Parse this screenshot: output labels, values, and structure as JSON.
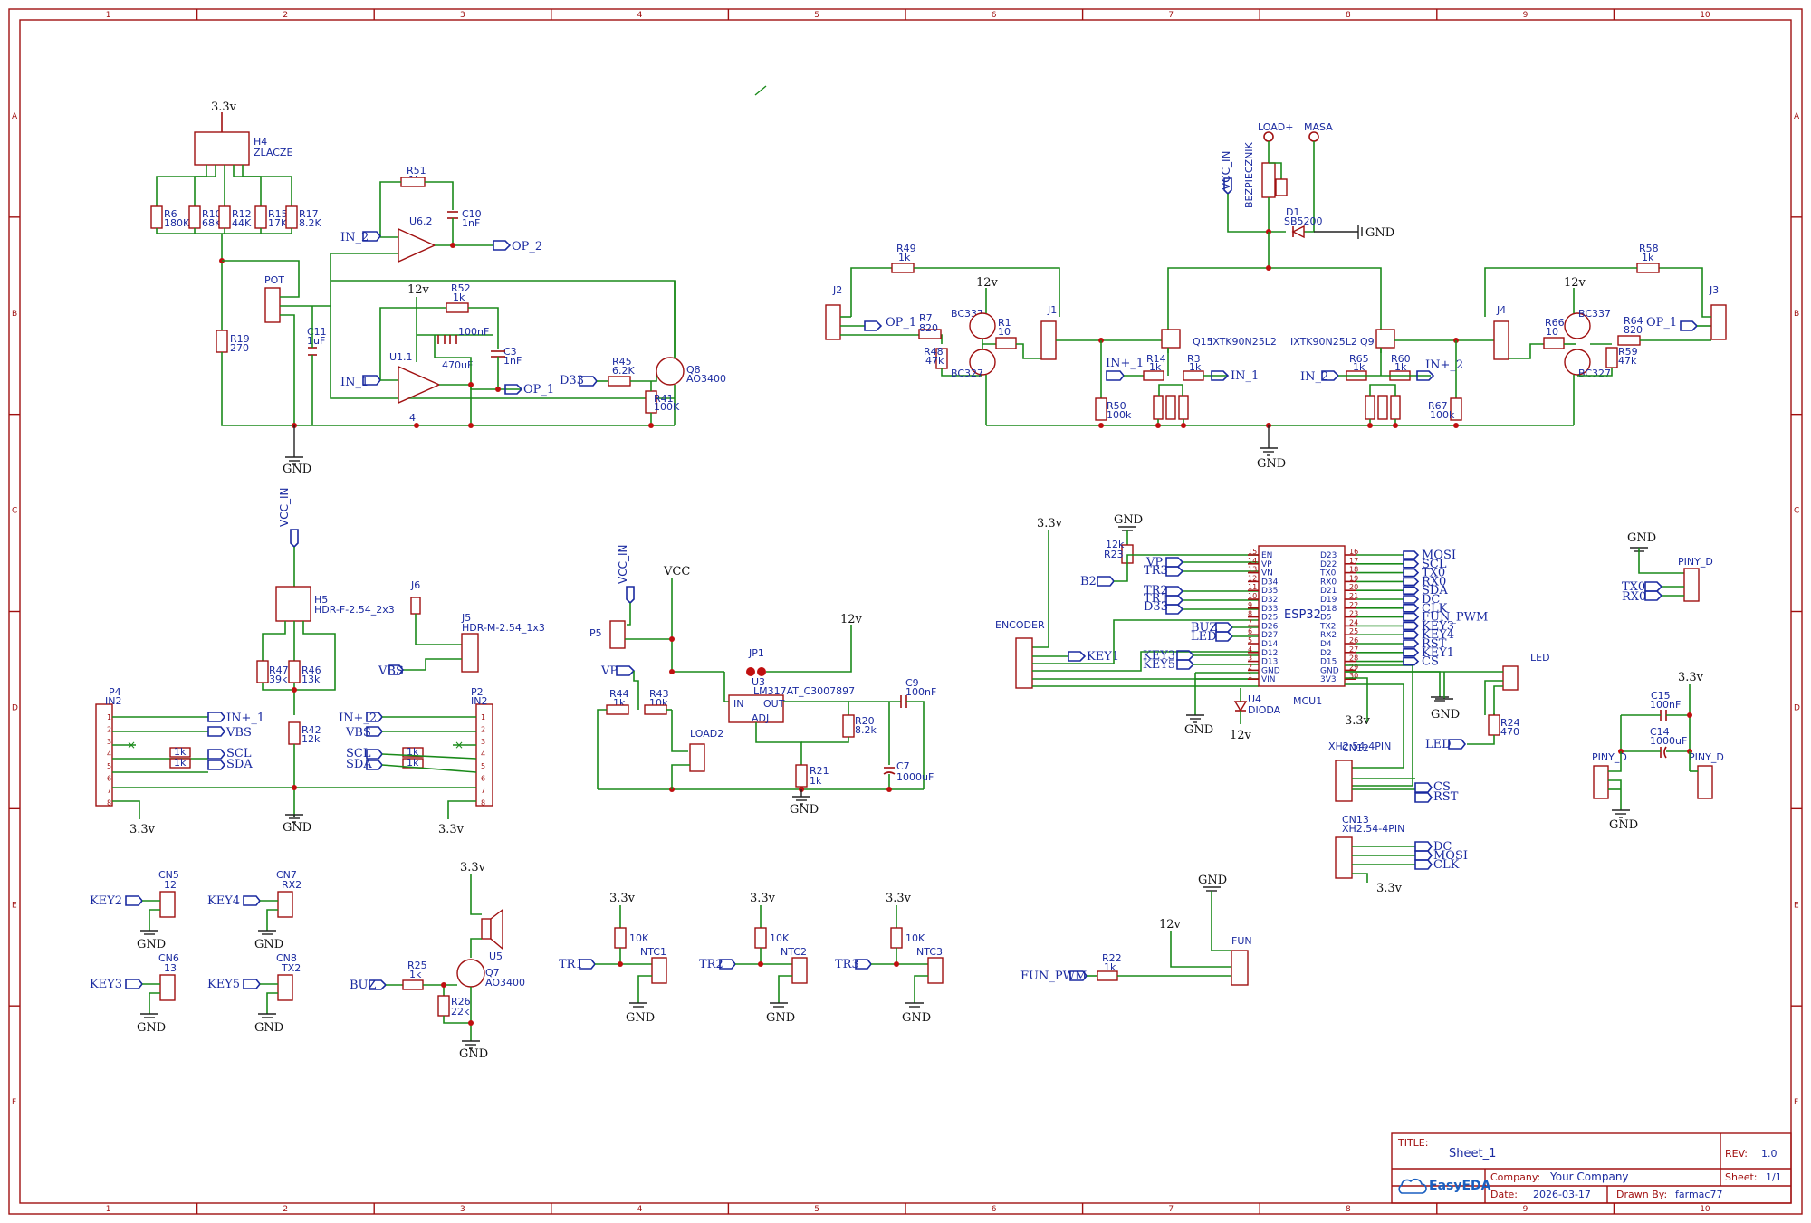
{
  "frame": {
    "cols": [
      "1",
      "2",
      "3",
      "4",
      "5",
      "6",
      "7",
      "8",
      "9",
      "10"
    ],
    "rows": [
      "A",
      "B",
      "C",
      "D",
      "E",
      "F"
    ]
  },
  "title_block": {
    "title_label": "TITLE:",
    "title": "Sheet_1",
    "rev_label": "REV:",
    "rev": "1.0",
    "company_label": "Company:",
    "company": "Your Company",
    "sheet_label": "Sheet:",
    "sheet": "1/1",
    "date_label": "Date:",
    "date": "2026-03-17",
    "drawn_label": "Drawn By:",
    "drawn": "farmac77",
    "logo": "EasyEDA"
  },
  "powers": {
    "v33": "3.3v",
    "v12": "12v",
    "gnd": "GND",
    "vcc": "VCC",
    "vcc_in": "VCC_IN"
  },
  "nets": {
    "in2": "IN_2",
    "in1": "IN_1",
    "op2": "OP_2",
    "op1": "OP_1",
    "d33": "D33",
    "in1p": "IN+_1",
    "in2p": "IN+_2",
    "vbs": "VBS",
    "scl": "SCL",
    "sda": "SDA",
    "vp": "VP",
    "tr3": "TR3",
    "b2": "B2",
    "tr2": "TR2",
    "tr1": "TR1",
    "d33b": "D33",
    "buz": "BUZ",
    "led": "LED",
    "key3": "KEY3",
    "key5": "KEY5",
    "key1": "KEY1",
    "key2": "KEY2",
    "key4": "KEY4",
    "tx0": "TX0",
    "rx0": "RX0",
    "fun_pwm": "FUN_PWM",
    "load_plus": "LOAD+",
    "masa": "MASA",
    "cs": "CS",
    "rst": "RST",
    "dc": "DC",
    "mosi": "MOSI",
    "clk": "CLK",
    "mcu_right": [
      "MOSI",
      "SCL",
      "TX0",
      "RX0",
      "SDA",
      "DC",
      "CLK",
      "FUN_PWM",
      "KEY3",
      "KEY4",
      "RST",
      "KEY1",
      "CS"
    ]
  },
  "parts": {
    "h4": "H4",
    "zlacze": "ZLACZE",
    "r6": "R6",
    "r6v": "180K",
    "r10": "R10",
    "r10v": "68K",
    "r12": "R12",
    "r12v": "44K",
    "r15": "R15",
    "r15v": "17K",
    "r17": "R17",
    "r17v": "8.2K",
    "r19": "R19",
    "r19v": "270",
    "pot": "POT",
    "c11": "C11",
    "c11v": "1uF",
    "r51": "R51",
    "r51v": "1k",
    "c10": "C10",
    "c10v": "1nF",
    "u62": "U6.2",
    "r52": "R52",
    "r52v": "1k",
    "u11": "U1.1",
    "c_470": "470uF",
    "c_100n": "100nF",
    "c3": "C3",
    "c3v": "1nF",
    "r45": "R45",
    "r45v": "6.2K",
    "q8": "Q8",
    "q8v": "AO3400",
    "r41": "R41",
    "r41v": "100K",
    "r49": "R49",
    "r49v": "1k",
    "j2": "J2",
    "r7": "R7",
    "r7v": "820",
    "r48": "R48",
    "r48v": "47k",
    "bc337": "BC337",
    "bc327": "BC327",
    "r1": "R1",
    "r1v": "10",
    "j1": "J1",
    "q15": "Q15",
    "ixtk": "IXTK90N25L2",
    "r14": "R14",
    "r14v": "1k",
    "r3": "R3",
    "r3v": "1k",
    "r50": "R50",
    "r50v": "100k",
    "bez": "BEZPIECZNIK",
    "d1": "D1",
    "d1v": "SB5200",
    "q9": "Q9",
    "r65": "R65",
    "r65v": "1k",
    "r60": "R60",
    "r60v": "1k",
    "r67": "R67",
    "r67v": "100k",
    "r58": "R58",
    "r58v": "1k",
    "j4": "J4",
    "r66": "R66",
    "r66v": "10",
    "r64": "R64",
    "r64v": "820",
    "r59": "R59",
    "r59v": "47k",
    "j3": "J3",
    "h5": "H5",
    "h5v": "HDR-F-2.54_2x3",
    "j6": "J6",
    "j5": "J5",
    "j5v": "HDR-M-2.54_1x3",
    "r47": "R47",
    "r47v": "39k",
    "r46": "R46",
    "r46v": "13k",
    "r42": "R42",
    "r42v": "12k",
    "p4": "P4",
    "in2lbl": "IN2",
    "p2": "P2",
    "p2lbl": "IN2",
    "r1k": "1k",
    "p5": "P5",
    "jp1": "JP1",
    "u3": "U3",
    "u3v": "LM317AT_C3007897",
    "u3in": "IN",
    "u3out": "OUT",
    "u3adj": "ADJ",
    "r44": "R44",
    "r44v": "1k",
    "r43": "R43",
    "r43v": "10k",
    "load2": "LOAD2",
    "c9": "C9",
    "c9v": "100nF",
    "r20": "R20",
    "r20v": "8.2k",
    "r21": "R21",
    "r21v": "1k",
    "c7": "C7",
    "c7v": "1000uF",
    "encoder": "ENCODER",
    "r23": "R23",
    "r23v": "12k",
    "esp32": "ESP32",
    "mcu1": "MCU1",
    "u4": "U4",
    "dioda": "DIODA",
    "cn12": "CN12",
    "cn12v": "XH2.54-4PIN",
    "cn13": "CN13",
    "cn13v": "XH2.54-4PIN",
    "r24": "R24",
    "r24v": "470",
    "ledconn": "LED",
    "piny": "PINY_D",
    "c15": "C15",
    "c15v": "100nF",
    "c14": "C14",
    "c14v": "1000uF",
    "cn5": "CN5",
    "cn5v": "12",
    "cn6": "CN6",
    "cn6v": "13",
    "cn7": "CN7",
    "cn7v": "RX2",
    "cn8": "CN8",
    "cn8v": "TX2",
    "r25": "R25",
    "r25v": "1k",
    "r26": "R26",
    "r26v": "22k",
    "q7": "Q7",
    "q7v": "AO3400",
    "u5": "U5",
    "ntc1": "NTC1",
    "ntc2": "NTC2",
    "ntc3": "NTC3",
    "r10k": "10K",
    "fun": "FUN",
    "r22": "R22",
    "r22v": "1k"
  },
  "esp_left": [
    "EN",
    "VP",
    "VN",
    "D34",
    "D35",
    "D32",
    "D33",
    "D25",
    "D26",
    "D27",
    "D14",
    "D12",
    "D13",
    "GND",
    "VIN"
  ],
  "esp_left_nums": [
    "15",
    "14",
    "13",
    "12",
    "11",
    "10",
    "9",
    "8",
    "7",
    "6",
    "5",
    "4",
    "3",
    "2",
    "1"
  ],
  "esp_right": [
    "D23",
    "D22",
    "TX0",
    "RX0",
    "D21",
    "D19",
    "D18",
    "D5",
    "TX2",
    "RX2",
    "D4",
    "D2",
    "D15",
    "GND",
    "3V3"
  ],
  "esp_right_nums": [
    "16",
    "17",
    "18",
    "19",
    "20",
    "21",
    "22",
    "23",
    "24",
    "25",
    "26",
    "27",
    "28",
    "29",
    "30"
  ],
  "p_pins": [
    "1",
    "2",
    "3",
    "4",
    "5",
    "6",
    "7",
    "8"
  ],
  "colors": {
    "wire": "#1a8a1a",
    "part": "#a01010",
    "net": "#1a2aa0",
    "junction": "#c01010"
  }
}
